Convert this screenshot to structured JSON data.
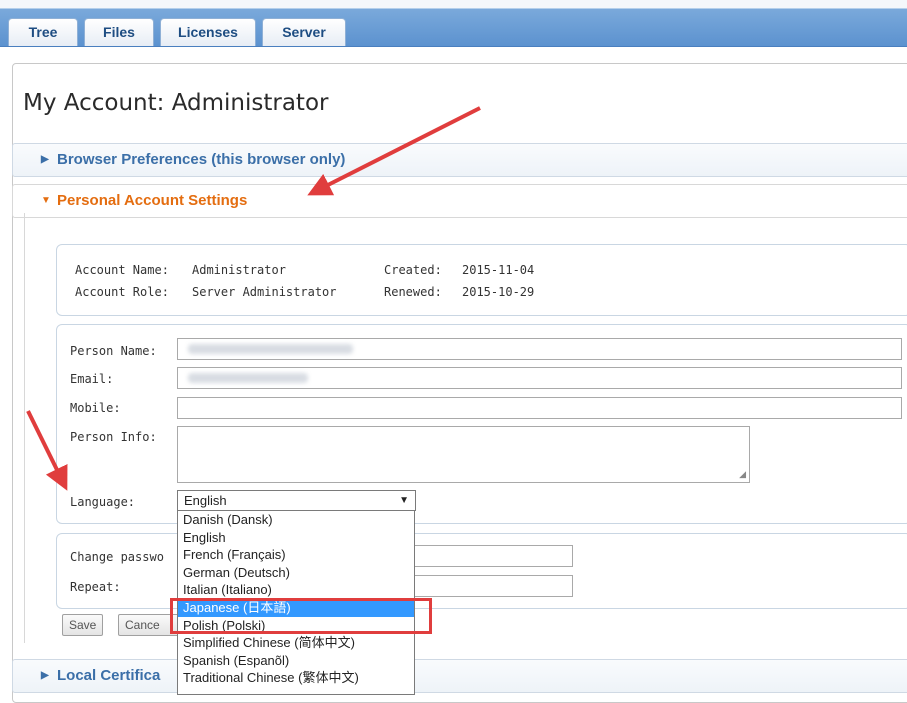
{
  "tabs": [
    {
      "label": "Tree"
    },
    {
      "label": "Files"
    },
    {
      "label": "Licenses"
    },
    {
      "label": "Server"
    }
  ],
  "page_title": "My Account: Administrator",
  "sections": {
    "browser_prefs": "Browser Preferences (this browser only)",
    "personal": "Personal Account Settings",
    "local_cert": "Local Certifica"
  },
  "account_info": {
    "name_label": "Account Name:",
    "name_value": "Administrator",
    "role_label": "Account Role:",
    "role_value": "Server Administrator",
    "created_label": "Created:",
    "created_value": "2015-11-04",
    "renewed_label": "Renewed:",
    "renewed_value": "2015-10-29"
  },
  "form": {
    "person_name_label": "Person Name:",
    "email_label": "Email:",
    "mobile_label": "Mobile:",
    "person_info_label": "Person Info:",
    "language_label": "Language:",
    "language_selected": "English"
  },
  "language_options": [
    "Danish (Dansk)",
    "English",
    "French (Français)",
    "German (Deutsch)",
    "Italian (Italiano)",
    "Japanese (日本語)",
    "Polish (Polski)",
    "Simplified Chinese (简体中文)",
    "Spanish (Espanõl)",
    "Traditional Chinese (繁体中文)"
  ],
  "highlighted_option": "Japanese (日本語)",
  "password": {
    "change_label": "Change passwo",
    "repeat_label": "Repeat:"
  },
  "buttons": {
    "save": "Save",
    "cancel": "Cance"
  },
  "colors": {
    "accent_blue": "#3b6fa8",
    "accent_orange": "#e46d10",
    "annotation_red": "#e03d3d",
    "selection_blue": "#3399ff"
  }
}
